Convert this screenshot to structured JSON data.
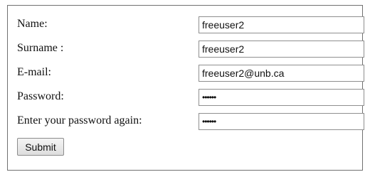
{
  "form": {
    "fields": [
      {
        "label": "Name:",
        "value": "freeuser2"
      },
      {
        "label": "Surname :",
        "value": "freeuser2"
      },
      {
        "label": "E-mail:",
        "value": "freeuser2@unb.ca"
      },
      {
        "label": "Password:",
        "value": "••••••"
      },
      {
        "label": "Enter your password again:",
        "value": "••••••"
      }
    ],
    "submit_label": "Submit"
  }
}
